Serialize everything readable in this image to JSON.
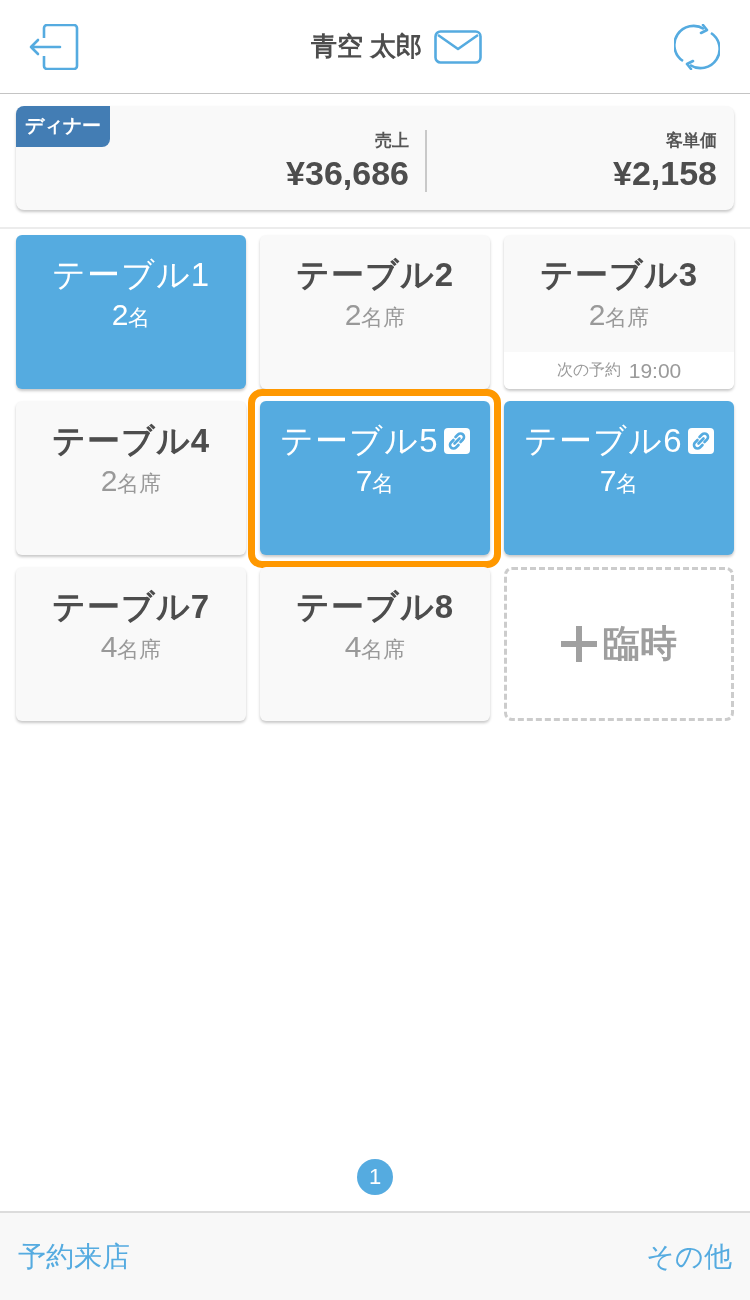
{
  "header": {
    "title": "青空 太郎"
  },
  "summary": {
    "badge": "ディナー",
    "metrics": [
      {
        "label": "売上",
        "value": "¥36,686"
      },
      {
        "label": "客単価",
        "value": "¥2,158"
      }
    ]
  },
  "tables": [
    {
      "kind": "table",
      "title": "テーブル1",
      "count": "2",
      "unit": "名",
      "occupied": true,
      "linked": false,
      "selected": false
    },
    {
      "kind": "table",
      "title": "テーブル2",
      "count": "2",
      "unit": "名席",
      "occupied": false,
      "linked": false,
      "selected": false
    },
    {
      "kind": "table",
      "title": "テーブル3",
      "count": "2",
      "unit": "名席",
      "occupied": false,
      "linked": false,
      "selected": false,
      "next_reservation": {
        "label": "次の予約",
        "time": "19:00"
      }
    },
    {
      "kind": "table",
      "title": "テーブル4",
      "count": "2",
      "unit": "名席",
      "occupied": false,
      "linked": false,
      "selected": false
    },
    {
      "kind": "table",
      "title": "テーブル5",
      "count": "7",
      "unit": "名",
      "occupied": true,
      "linked": true,
      "selected": true
    },
    {
      "kind": "table",
      "title": "テーブル6",
      "count": "7",
      "unit": "名",
      "occupied": true,
      "linked": true,
      "selected": false
    },
    {
      "kind": "table",
      "title": "テーブル7",
      "count": "4",
      "unit": "名席",
      "occupied": false,
      "linked": false,
      "selected": false
    },
    {
      "kind": "table",
      "title": "テーブル8",
      "count": "4",
      "unit": "名席",
      "occupied": false,
      "linked": false,
      "selected": false
    },
    {
      "kind": "add",
      "label": "臨時",
      "selected": false
    }
  ],
  "pagination": {
    "pages": [
      {
        "label": "1",
        "selected": true
      }
    ]
  },
  "footer": {
    "actions": [
      {
        "label": "予約来店"
      },
      {
        "label": "その他"
      }
    ]
  }
}
